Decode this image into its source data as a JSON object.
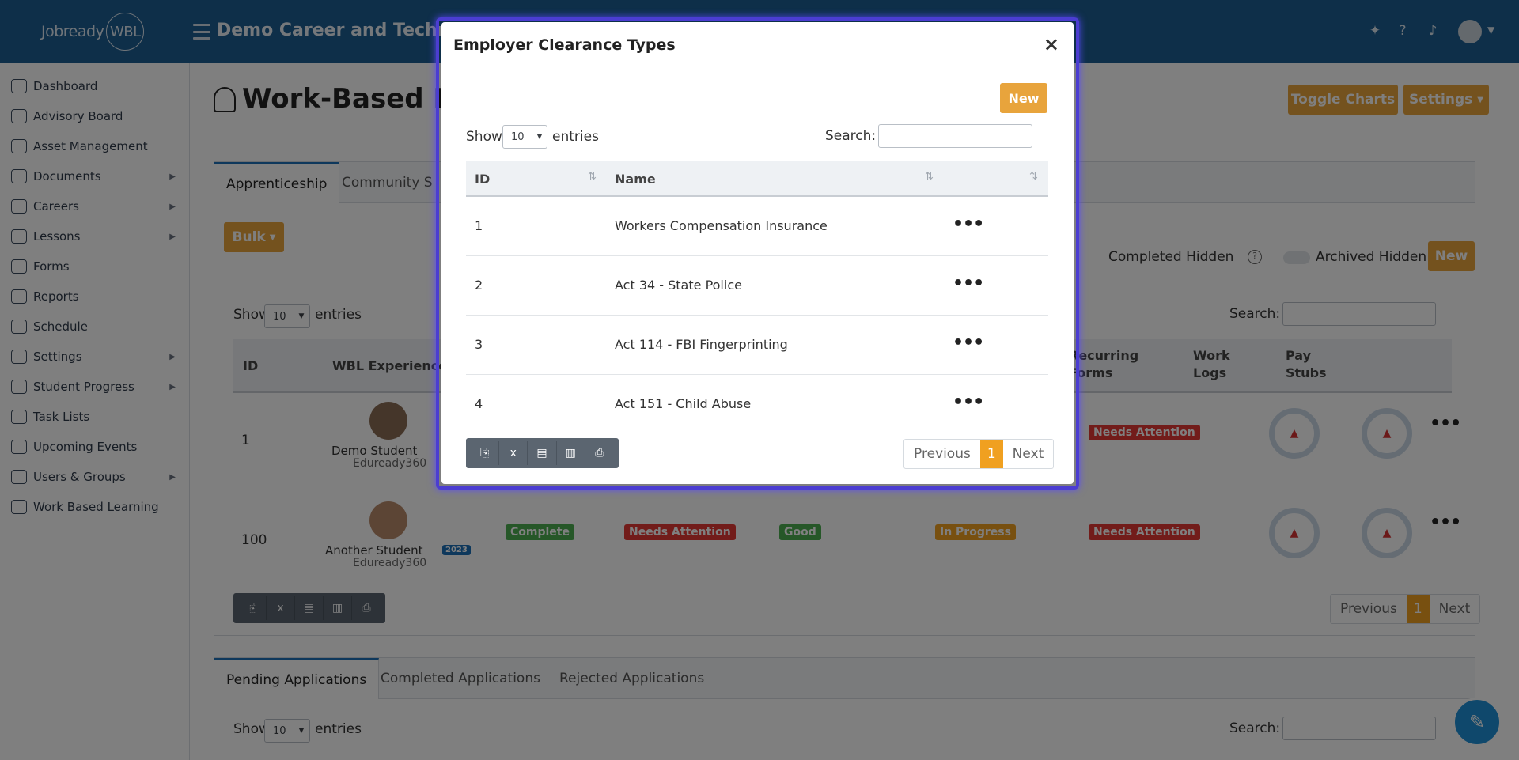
{
  "topbar": {
    "logo_text": "Jobready",
    "logo_badge": "WBL",
    "school_name": "Demo Career and Technolog"
  },
  "icons": {
    "bulb": "lightbulb-icon",
    "help": "question-circle-icon",
    "bell": "bell-icon",
    "user": "user-avatar-icon"
  },
  "sidebar": {
    "items": [
      {
        "label": "Dashboard",
        "icon": "dashboard-icon"
      },
      {
        "label": "Advisory Board",
        "icon": "advisory-icon"
      },
      {
        "label": "Asset Management",
        "icon": "asset-icon"
      },
      {
        "label": "Documents",
        "icon": "document-icon"
      },
      {
        "label": "Careers",
        "icon": "careers-icon"
      },
      {
        "label": "Lessons",
        "icon": "lessons-icon"
      },
      {
        "label": "Forms",
        "icon": "forms-icon"
      },
      {
        "label": "Reports",
        "icon": "reports-icon"
      },
      {
        "label": "Schedule",
        "icon": "clock-icon"
      },
      {
        "label": "Settings",
        "icon": "settings-icon"
      },
      {
        "label": "Student Progress",
        "icon": "progress-icon"
      },
      {
        "label": "Task Lists",
        "icon": "tasklist-icon"
      },
      {
        "label": "Upcoming Events",
        "icon": "bell-icon"
      },
      {
        "label": "Users & Groups",
        "icon": "users-icon"
      },
      {
        "label": "Work Based Learning",
        "icon": "wbl-icon"
      }
    ]
  },
  "page": {
    "title": "Work-Based Le",
    "toggle_charts": "Toggle Charts",
    "settings": "Settings",
    "tabs": [
      "Apprenticeship",
      "Community S"
    ],
    "bulk": "Bulk",
    "completed_hidden": "Completed Hidden",
    "archived_hidden": "Archived Hidden",
    "new": "New",
    "show": "Show",
    "entries_value": "10",
    "entries": "entries",
    "search": "Search:",
    "columns": {
      "id": "ID",
      "wbl": "WBL Experience",
      "recurring": "Recurring Forms",
      "worklogs": "Work Logs",
      "paystubs": "Pay Stubs"
    },
    "rows": [
      {
        "id": "1",
        "name": "Demo Student",
        "org": "Eduready360",
        "badge_recurring": "Needs Attention"
      },
      {
        "id": "100",
        "name": "Another Student",
        "year": "2023",
        "org": "Eduready360",
        "status1": "Complete",
        "status2": "Needs Attention",
        "status3": "Good",
        "status4": "In Progress",
        "badge_recurring": "Needs Attention"
      }
    ],
    "pager": {
      "prev": "Previous",
      "cur": "1",
      "next": "Next"
    },
    "tabs2": [
      "Pending Applications",
      "Completed Applications",
      "Rejected Applications"
    ]
  },
  "modal": {
    "title": "Employer Clearance Types",
    "new_button": "New",
    "show": "Show",
    "entries_value": "10",
    "entries": "entries",
    "search": "Search:",
    "col_id": "ID",
    "col_name": "Name",
    "rows": [
      {
        "id": "1",
        "name": "Workers Compensation Insurance"
      },
      {
        "id": "2",
        "name": "Act 34 - State Police"
      },
      {
        "id": "3",
        "name": "Act 114 - FBI Fingerprinting"
      },
      {
        "id": "4",
        "name": "Act 151 - Child Abuse"
      }
    ],
    "pager": {
      "prev": "Previous",
      "cur": "1",
      "next": "Next"
    }
  },
  "colors": {
    "topbar": "#1d5f93",
    "accent": "#e8a43c",
    "modal_border": "#4b3dd1"
  }
}
